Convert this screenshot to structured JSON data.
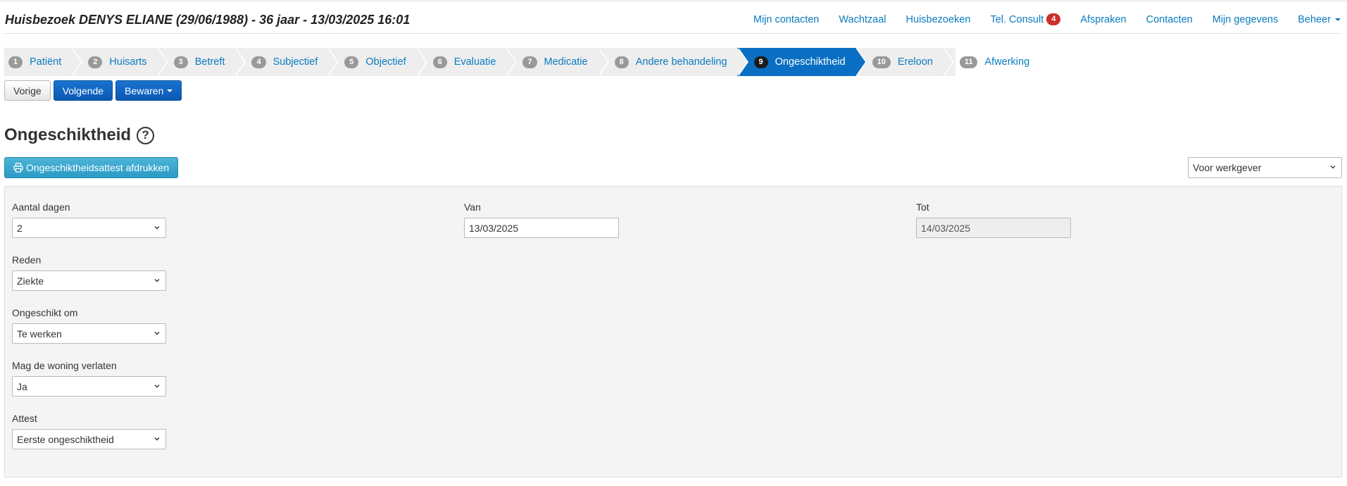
{
  "header": {
    "title": "Huisbezoek DENYS ELIANE (29/06/1988) - 36 jaar - 13/03/2025 16:01",
    "nav": [
      {
        "label": "Mijn contacten"
      },
      {
        "label": "Wachtzaal"
      },
      {
        "label": "Huisbezoeken"
      },
      {
        "label": "Tel. Consult",
        "badge": "4"
      },
      {
        "label": "Afspraken"
      },
      {
        "label": "Contacten"
      },
      {
        "label": "Mijn gegevens"
      },
      {
        "label": "Beheer",
        "dropdown": true
      }
    ]
  },
  "steps": [
    {
      "num": "1",
      "label": "Patiënt"
    },
    {
      "num": "2",
      "label": "Huisarts"
    },
    {
      "num": "3",
      "label": "Betreft"
    },
    {
      "num": "4",
      "label": "Subjectief"
    },
    {
      "num": "5",
      "label": "Objectief"
    },
    {
      "num": "6",
      "label": "Evaluatie"
    },
    {
      "num": "7",
      "label": "Medicatie"
    },
    {
      "num": "8",
      "label": "Andere behandeling"
    },
    {
      "num": "9",
      "label": "Ongeschiktheid",
      "active": true
    },
    {
      "num": "10",
      "label": "Ereloon"
    },
    {
      "num": "11",
      "label": "Afwerking"
    }
  ],
  "buttons": {
    "prev": "Vorige",
    "next": "Volgende",
    "save": "Bewaren"
  },
  "page": {
    "title": "Ongeschiktheid",
    "help_glyph": "?",
    "print_button": "Ongeschiktheidsattest afdrukken",
    "recipient_select": "Voor werkgever"
  },
  "form": {
    "aantal_dagen": {
      "label": "Aantal dagen",
      "value": "2"
    },
    "van": {
      "label": "Van",
      "value": "13/03/2025"
    },
    "tot": {
      "label": "Tot",
      "value": "14/03/2025"
    },
    "reden": {
      "label": "Reden",
      "value": "Ziekte"
    },
    "ongeschikt_om": {
      "label": "Ongeschikt om",
      "value": "Te werken"
    },
    "woning_verlaten": {
      "label": "Mag de woning verlaten",
      "value": "Ja"
    },
    "attest": {
      "label": "Attest",
      "value": "Eerste ongeschiktheid"
    }
  },
  "colors": {
    "link": "#0a7bc1",
    "active_step": "#0a6fc2",
    "primary_button": "#0b57b4",
    "info_button": "#2a9bc6",
    "badge": "#c9302c"
  }
}
